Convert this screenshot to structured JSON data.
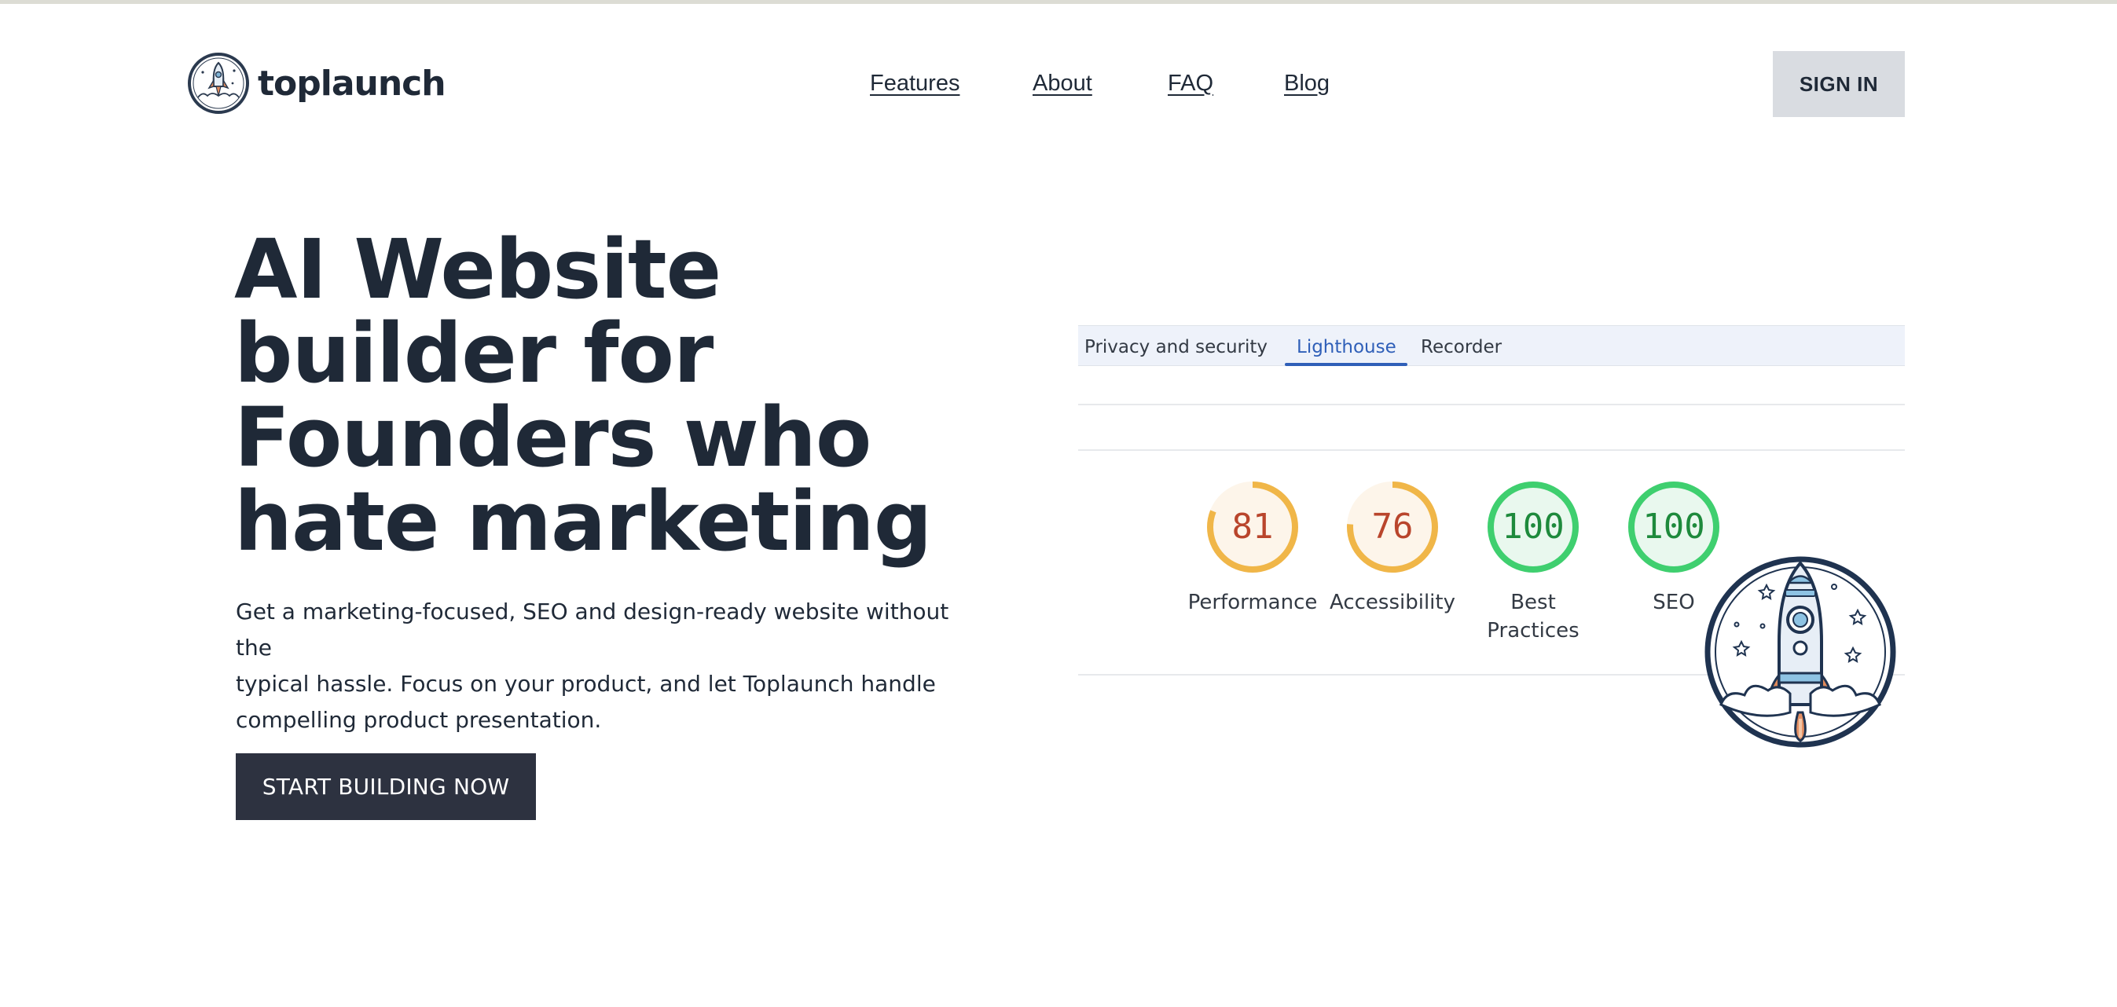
{
  "brand": {
    "name": "toplaunch"
  },
  "nav": {
    "items": [
      {
        "label": "Features"
      },
      {
        "label": "About"
      },
      {
        "label": "FAQ"
      },
      {
        "label": "Blog"
      }
    ],
    "signin_label": "SIGN IN"
  },
  "hero": {
    "title_lines": [
      "AI Website",
      "builder for",
      "Founders who",
      "hate marketing"
    ],
    "subtitle_lines": [
      "Get a marketing-focused, SEO and design-ready website without the",
      "typical hassle. Focus on your product, and let Toplaunch handle",
      "compelling product presentation."
    ],
    "cta_label": "START BUILDING NOW"
  },
  "lighthouse": {
    "tabs": [
      {
        "label": "Privacy and security",
        "active": false
      },
      {
        "label": "Lighthouse",
        "active": true
      },
      {
        "label": "Recorder",
        "active": false
      }
    ],
    "scores": [
      {
        "value": "81",
        "label_lines": [
          "Performance"
        ],
        "score": 81,
        "color": "#f0b648",
        "text_color": "#b9452c",
        "bg": "#fdf5ea"
      },
      {
        "value": "76",
        "label_lines": [
          "Accessibility"
        ],
        "score": 76,
        "color": "#f0b648",
        "text_color": "#b9452c",
        "bg": "#fdf5ea"
      },
      {
        "value": "100",
        "label_lines": [
          "Best",
          "Practices"
        ],
        "score": 100,
        "color": "#3fcf6f",
        "text_color": "#1e8a3c",
        "bg": "#e9f8ee"
      },
      {
        "value": "100",
        "label_lines": [
          "SEO"
        ],
        "score": 100,
        "color": "#3fcf6f",
        "text_color": "#1e8a3c",
        "bg": "#e9f8ee"
      }
    ]
  },
  "icons": {
    "logo": "rocket-logo-icon",
    "badge": "rocket-badge-icon"
  },
  "colors": {
    "text": "#1f2937",
    "cta_bg": "#2d3240",
    "signin_bg": "#d9dce1",
    "tab_active": "#2f5fb8"
  }
}
